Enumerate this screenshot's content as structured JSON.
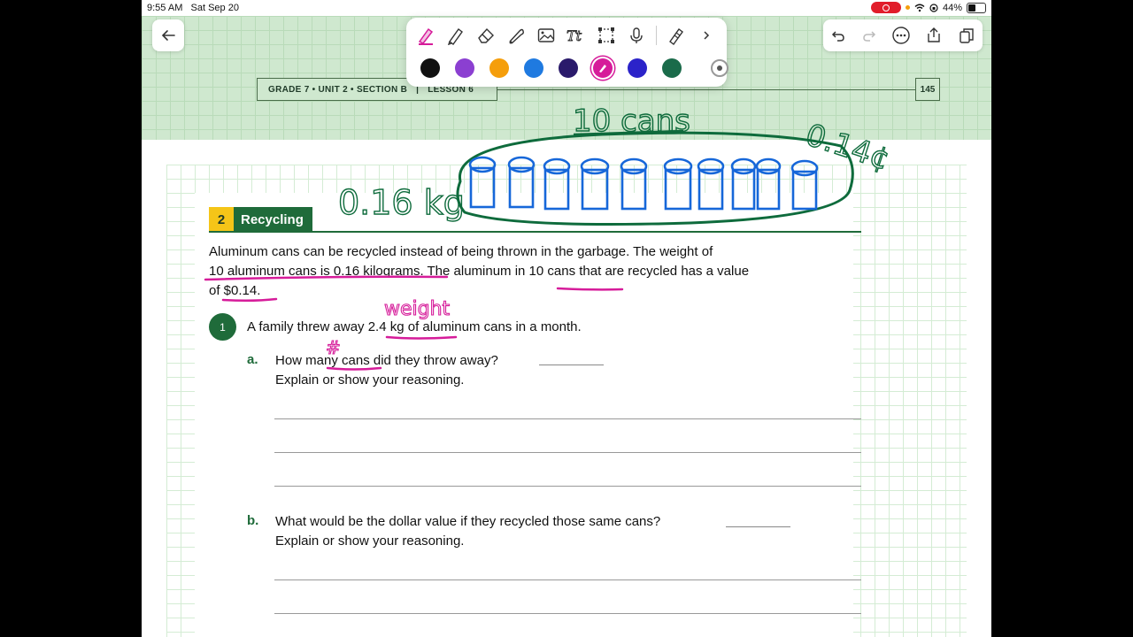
{
  "status_bar": {
    "time": "9:55 AM",
    "date": "Sat Sep 20",
    "battery": "44%"
  },
  "header": {
    "lesson_bar_grade": "GRADE 7 • UNIT 2 • SECTION B",
    "lesson_bar_separator": "|",
    "lesson_bar_lesson": "LESSON 6",
    "page_number": "145"
  },
  "toolbar": {
    "tools": [
      "highlighter-pen-icon",
      "pen-icon",
      "eraser-icon",
      "lasso-icon",
      "image-icon",
      "text-icon",
      "selection-box-icon",
      "microphone-icon",
      "pencil-icon",
      "chevron-right-icon"
    ],
    "colors": [
      "#111111",
      "#8b3fd1",
      "#f59e0b",
      "#1f7ae0",
      "#2a1a6b",
      "#d61c9a",
      "#2b23c9",
      "#1a6b4a"
    ],
    "selected_color": "#d61c9a"
  },
  "section": {
    "number": "2",
    "title": "Recycling"
  },
  "intro": {
    "line1": "Aluminum cans can be recycled instead of being thrown in the garbage. The weight of",
    "line2": "10 aluminum cans is 0.16 kilograms. The aluminum in 10 cans that are recycled has a value",
    "line3": "of $0.14."
  },
  "question1": {
    "number": "1",
    "prompt": "A family threw away 2.4 kg of aluminum cans in a month.",
    "a": {
      "letter": "a.",
      "text": "How many cans did they throw away?",
      "explain": "Explain or show your reasoning."
    },
    "b": {
      "letter": "b.",
      "text": "What would be the dollar value if they recycled those same cans?",
      "explain": "Explain or show your reasoning."
    }
  },
  "handwriting": {
    "ten_cans": "10 cans",
    "price": "0.14¢",
    "weight_kg": "0.16 kg",
    "weight_word": "weight",
    "hash": "#"
  },
  "ink_colors": {
    "green": "#0e6b3c",
    "blue": "#1667d9",
    "magenta": "#d61c9a"
  }
}
